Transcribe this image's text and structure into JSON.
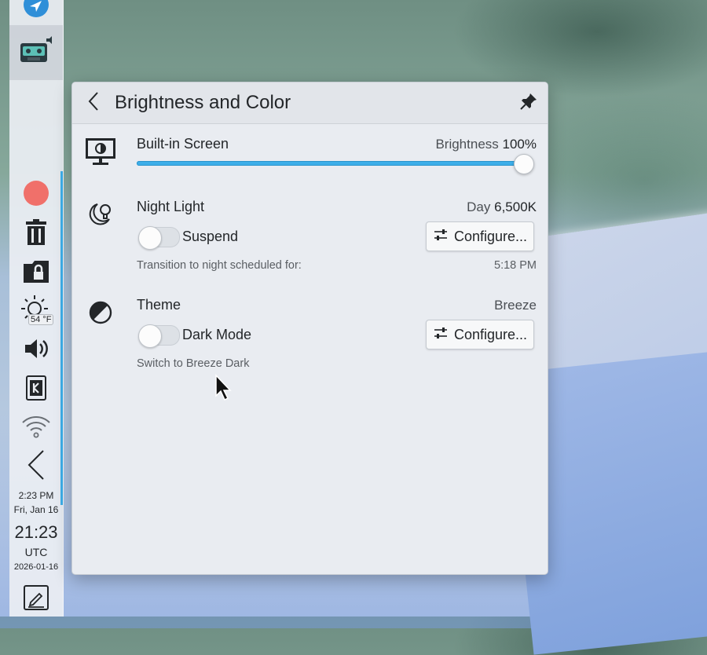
{
  "popup": {
    "title": "Brightness and Color",
    "screen": {
      "label": "Built-in Screen",
      "brightness_label": "Brightness",
      "brightness_value": "100%",
      "brightness_level": 1.0
    },
    "night_light": {
      "label": "Night Light",
      "status_label": "Day",
      "status_value": "6,500K",
      "toggle_label": "Suspend",
      "toggle_on": false,
      "configure_label": "Configure...",
      "transition_text": "Transition to night scheduled for:",
      "transition_time": "5:18 PM"
    },
    "theme": {
      "label": "Theme",
      "current": "Breeze",
      "toggle_label": "Dark Mode",
      "toggle_on": false,
      "configure_label": "Configure...",
      "hint": "Switch to Breeze Dark"
    }
  },
  "taskbar": {
    "weather_temp": "54 °F",
    "clock_local_time": "2:23 PM",
    "clock_local_date": "Fri, Jan 16",
    "clock_utc_time": "21:23",
    "clock_utc_zone": "UTC",
    "clock_utc_date": "2026-01-16",
    "icons": [
      "launcher-icon",
      "audio-cassette-icon",
      "record-icon",
      "trash-icon",
      "vault-icon",
      "weather-icon",
      "volume-icon",
      "kde-connect-icon",
      "wifi-icon",
      "collapse-arrow-icon",
      "notes-icon"
    ]
  },
  "colors": {
    "accent": "#3daee9",
    "record": "#f0706a",
    "popup_bg": "#e9ecf1"
  }
}
